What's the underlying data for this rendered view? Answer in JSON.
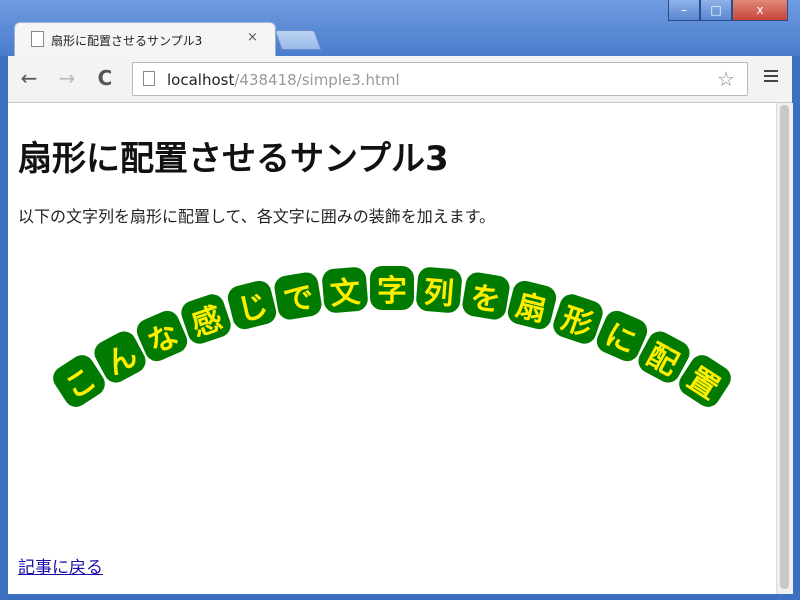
{
  "browser": {
    "tab_title": "扇形に配置させるサンプル3",
    "tab_close": "×",
    "url_host": "localhost",
    "url_path": "/438418/simple3.html",
    "window_min": "–",
    "window_max": "□",
    "window_close": "x",
    "back": "←",
    "forward": "→",
    "reload": "C",
    "star": "☆"
  },
  "page": {
    "heading": "扇形に配置させるサンプル3",
    "description": "以下の文字列を扇形に配置して、各文字に囲みの装飾を加えます。",
    "fan_text": "こんな感じで文字列を扇形に配置",
    "back_link": "記事に戻る"
  },
  "colors": {
    "badge_bg": "#007a00",
    "badge_fg": "#ffee00",
    "link": "#1a0dab"
  }
}
